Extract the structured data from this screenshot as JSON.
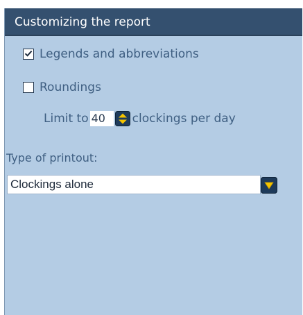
{
  "panel": {
    "title": "Customizing the report",
    "legends": {
      "label": "Legends and abbreviations",
      "checked": true
    },
    "roundings": {
      "label": "Roundings",
      "checked": false
    },
    "limit": {
      "prefix": "Limit to",
      "value": "40",
      "suffix": "clockings per day"
    },
    "printout": {
      "label": "Type of printout:",
      "selected": "Clockings alone"
    }
  },
  "colors": {
    "panel_bg": "#b4cce4",
    "header_bg": "#34506f",
    "text": "#3f5f82",
    "accent_yellow": "#f5c400"
  }
}
